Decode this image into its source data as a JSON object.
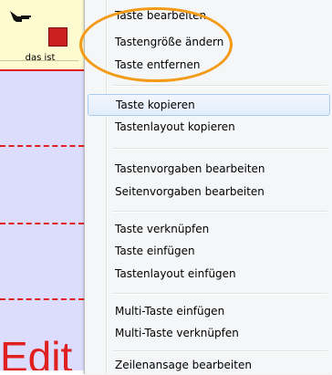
{
  "grid": {
    "top_cell_label": "das ist",
    "big_text": "Edit"
  },
  "menu": {
    "items": [
      {
        "label": "Taste bearbeiten"
      },
      {
        "label": "Tastengröße ändern"
      },
      {
        "label": "Taste entfernen"
      },
      {
        "label": "Taste kopieren",
        "selected": true
      },
      {
        "label": "Tastenlayout kopieren"
      },
      {
        "label": "Tastenvorgaben bearbeiten"
      },
      {
        "label": "Seitenvorgaben bearbeiten"
      },
      {
        "label": "Taste verknüpfen"
      },
      {
        "label": "Taste einfügen"
      },
      {
        "label": "Tastenlayout einfügen"
      },
      {
        "label": "Multi-Taste einfügen"
      },
      {
        "label": "Multi-Taste verknüpfen"
      },
      {
        "label": "Zeilenansage bearbeiten"
      }
    ]
  },
  "colors": {
    "highlight_ring": "#f39a17",
    "grid_divider": "#e02020",
    "cell_top_bg": "#fdfbcf",
    "cell_bg": "#dcdcff"
  }
}
